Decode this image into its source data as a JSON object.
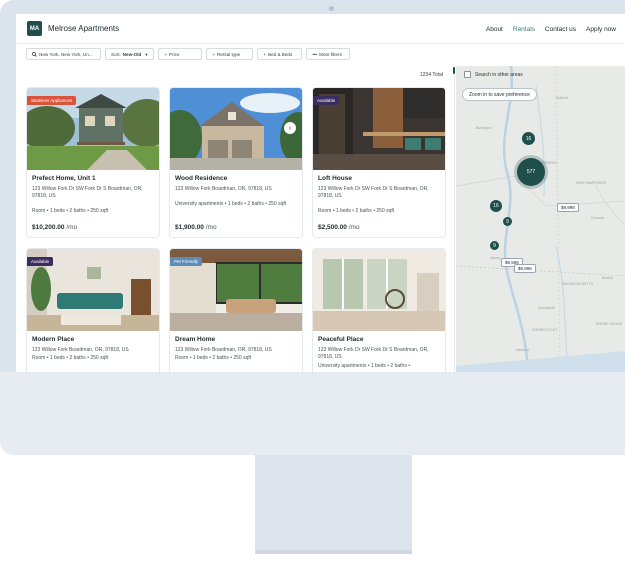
{
  "app": {
    "logo": "MA",
    "name": "Melrose Apartments"
  },
  "nav": {
    "items": [
      "About",
      "Rentals",
      "Contact us",
      "Apply now"
    ],
    "active": "Rentals"
  },
  "filters": {
    "location": "New York, New York, Un...",
    "sort_label": "Sort:",
    "sort_value": "New-Old",
    "price": "Price",
    "rental_type": "Rental type",
    "bed_baths": "Bed & Beds",
    "more_filters": "More filters"
  },
  "results": {
    "total": "1234 Total"
  },
  "listings": [
    {
      "badge": "Stainless Appliances",
      "badge_color": "#d9533b",
      "title": "Prefect Home, Unit 1",
      "address": "123 Willow Fork Dr SW Fork Dr S Boardman, OR, 97818, US",
      "details": "Room • 1 beds • 2 baths • 250 sqft",
      "price": "$10,200.00",
      "period": "/mo"
    },
    {
      "badge": "",
      "title": "Wood Residence",
      "address": "123 Willow Fork Boardman, OR, 97818, US",
      "details": "University apartments • 1 beds • 2 baths • 250 sqft",
      "price": "$1,900.00",
      "period": "/mo"
    },
    {
      "badge": "Available",
      "badge_color": "#3b2d5e",
      "title": "Loft House",
      "address": "123 Willow Fork Dr SW Fork Dr S Boardman, OR, 97818, US",
      "details": "Room • 1 beds • 2 baths • 250 sqft",
      "price": "$2,500.00",
      "period": "/mo"
    },
    {
      "badge": "Available",
      "badge_color": "#3b2d5e",
      "title": "Modern Place",
      "address": "123 Willow Fork Boardman, OR, 97818, US",
      "details": "Room • 1 beds • 2 baths • 250 sqft"
    },
    {
      "badge": "Pet Friendly",
      "badge_color": "#5b8db8",
      "title": "Dream Home",
      "address": "123 Willow Fork Boardman, OR, 97818, US",
      "details": "Room • 1 beds • 2 baths • 250 sqft"
    },
    {
      "badge": "",
      "title": "Peaceful Place",
      "address": "123 Willow Fork Dr SW Fork Dr S Boardman, OR, 97818, US",
      "details": "University apartments • 1 beds • 2 baths •"
    }
  ],
  "map": {
    "search_label": "Search in other areas",
    "zoom_label": "Zoom in to save preference",
    "clusters": [
      "16",
      "577",
      "16",
      "9",
      "9"
    ],
    "pins": [
      "$9,998",
      "$9,998",
      "$9,998"
    ],
    "labels": [
      "Rutland",
      "Concord",
      "Albany",
      "Springfield",
      "MASSACHUSETTS",
      "RHODE ISLAND",
      "CONNECTICUT",
      "NEW HAMPSHIRE",
      "Hartford",
      "Boston",
      "VERMONT",
      "Burlington"
    ]
  }
}
